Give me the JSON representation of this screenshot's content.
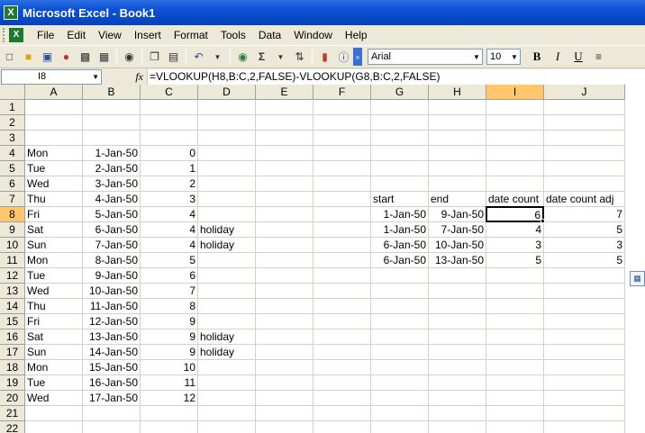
{
  "window": {
    "title": "Microsoft Excel - Book1"
  },
  "menu": [
    "File",
    "Edit",
    "View",
    "Insert",
    "Format",
    "Tools",
    "Data",
    "Window",
    "Help"
  ],
  "toolbar": {
    "font": "Arial",
    "font_size": "10",
    "bold": "B",
    "italic": "I",
    "underline": "U"
  },
  "formula_bar": {
    "name_box": "I8",
    "fx": "fx",
    "formula": "=VLOOKUP(H8,B:C,2,FALSE)-VLOOKUP(G8,B:C,2,FALSE)"
  },
  "columns": [
    "A",
    "B",
    "C",
    "D",
    "E",
    "F",
    "G",
    "H",
    "I",
    "J"
  ],
  "selected_column": "I",
  "selected_row": 8,
  "rows": [
    1,
    2,
    3,
    4,
    5,
    6,
    7,
    8,
    9,
    10,
    11,
    12,
    13,
    14,
    15,
    16,
    17,
    18,
    19,
    20,
    21,
    22
  ],
  "cells": {
    "A4": "Mon",
    "B4": "1-Jan-50",
    "C4": "0",
    "A5": "Tue",
    "B5": "2-Jan-50",
    "C5": "1",
    "A6": "Wed",
    "B6": "3-Jan-50",
    "C6": "2",
    "A7": "Thu",
    "B7": "4-Jan-50",
    "C7": "3",
    "A8": "Fri",
    "B8": "5-Jan-50",
    "C8": "4",
    "A9": "Sat",
    "B9": "6-Jan-50",
    "C9": "4",
    "D9": "holiday",
    "A10": "Sun",
    "B10": "7-Jan-50",
    "C10": "4",
    "D10": "holiday",
    "A11": "Mon",
    "B11": "8-Jan-50",
    "C11": "5",
    "A12": "Tue",
    "B12": "9-Jan-50",
    "C12": "6",
    "A13": "Wed",
    "B13": "10-Jan-50",
    "C13": "7",
    "A14": "Thu",
    "B14": "11-Jan-50",
    "C14": "8",
    "A15": "Fri",
    "B15": "12-Jan-50",
    "C15": "9",
    "A16": "Sat",
    "B16": "13-Jan-50",
    "C16": "9",
    "D16": "holiday",
    "A17": "Sun",
    "B17": "14-Jan-50",
    "C17": "9",
    "D17": "holiday",
    "A18": "Mon",
    "B18": "15-Jan-50",
    "C18": "10",
    "A19": "Tue",
    "B19": "16-Jan-50",
    "C19": "11",
    "A20": "Wed",
    "B20": "17-Jan-50",
    "C20": "12",
    "G7": "start",
    "H7": "end",
    "I7": "date count",
    "J7": "date count adj",
    "G8": "1-Jan-50",
    "H8": "9-Jan-50",
    "I8": "6",
    "J8": "7",
    "G9": "1-Jan-50",
    "H9": "7-Jan-50",
    "I9": "4",
    "J9": "5",
    "G10": "6-Jan-50",
    "H10": "10-Jan-50",
    "I10": "3",
    "J10": "3",
    "G11": "6-Jan-50",
    "H11": "13-Jan-50",
    "I11": "5",
    "J11": "5"
  },
  "right_aligned_columns": [
    "B",
    "C",
    "G",
    "H",
    "I",
    "J"
  ],
  "active_cell": "I8"
}
